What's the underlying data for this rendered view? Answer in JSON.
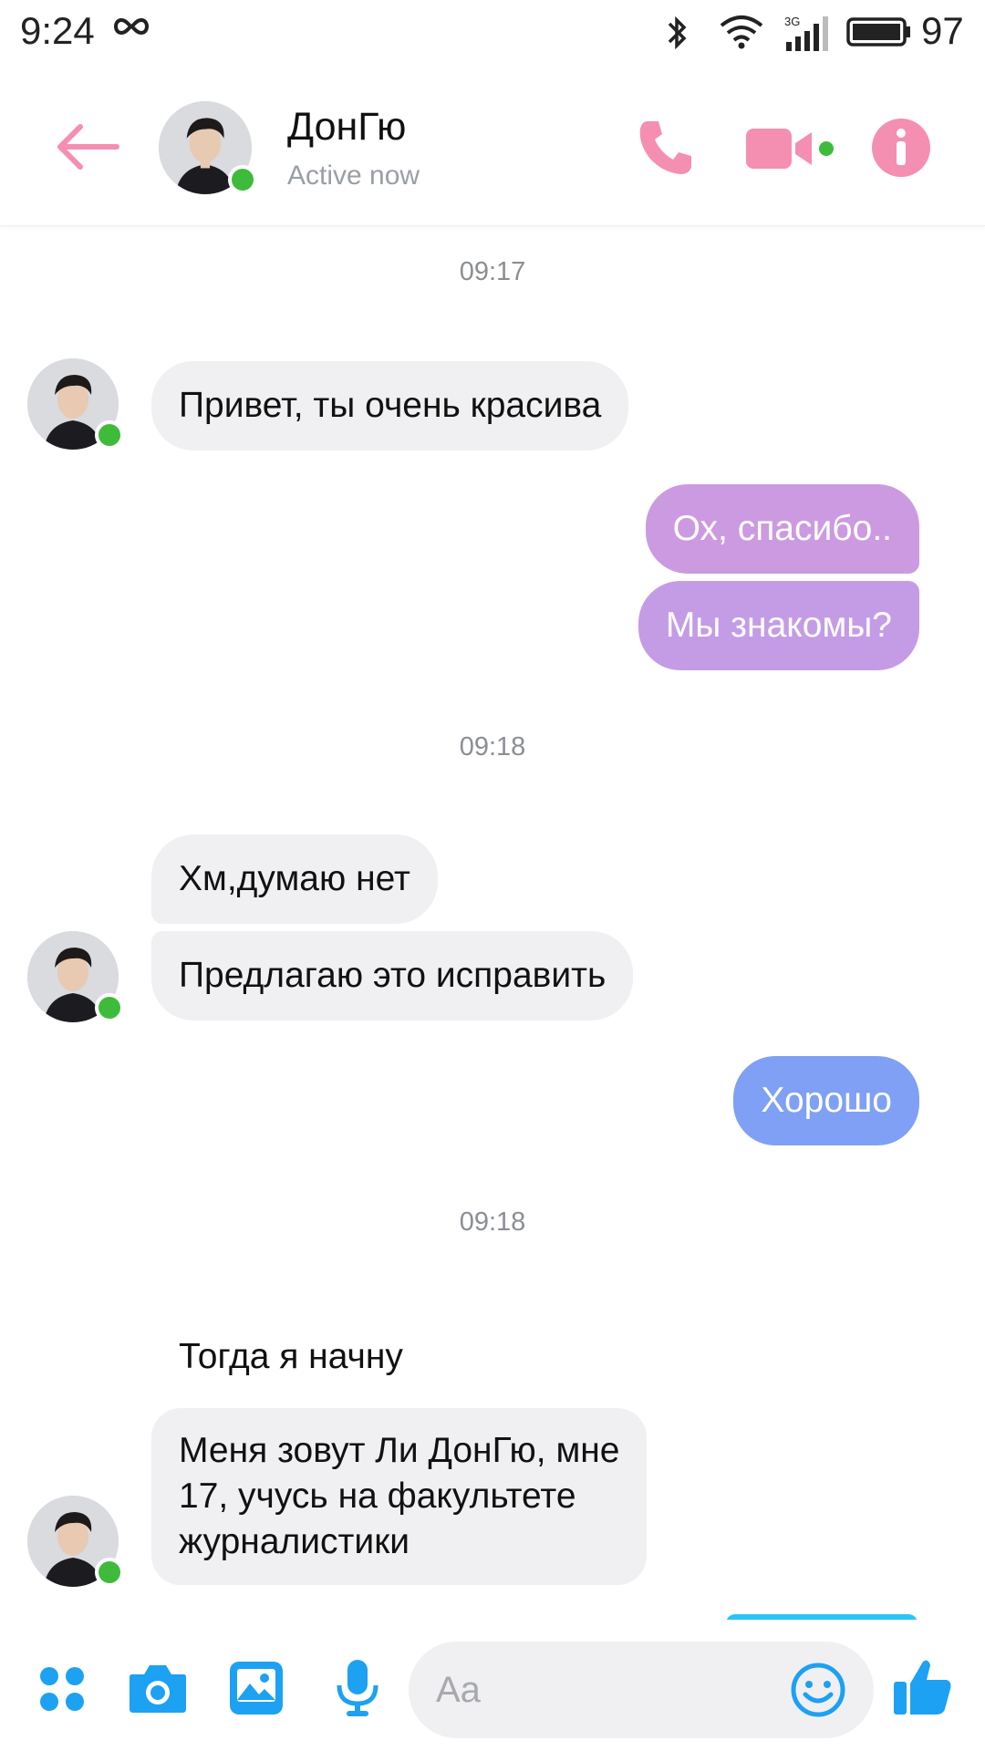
{
  "status_bar": {
    "time": "9:24",
    "network": "3G",
    "battery": "97"
  },
  "header": {
    "contact_name": "ДонГю",
    "status": "Active now",
    "accent_color": "#f48fb1",
    "icons": [
      "back-arrow-icon",
      "phone-icon",
      "video-camera-icon",
      "info-icon"
    ]
  },
  "messages": [
    {
      "type": "timestamp",
      "text": "09:17"
    },
    {
      "type": "incoming",
      "text": "Привет, ты очень красива"
    },
    {
      "type": "outgoing",
      "text": "Ох, спасибо..",
      "color": "#cc9ae0"
    },
    {
      "type": "outgoing",
      "text": "Мы знакомы?",
      "color": "#c49ce6"
    },
    {
      "type": "timestamp",
      "text": "09:18"
    },
    {
      "type": "incoming",
      "text": "Хм,думаю нет"
    },
    {
      "type": "incoming",
      "text": "Предлагаю это исправить"
    },
    {
      "type": "outgoing",
      "text": "Хорошо",
      "color": "#7fa0f4"
    },
    {
      "type": "timestamp",
      "text": "09:18"
    },
    {
      "type": "incoming_plain",
      "text": "Тогда я начну"
    },
    {
      "type": "incoming",
      "lines": [
        "Меня зовут Ли ДонГю, мне",
        "17, учусь на факультете",
        "журналистики"
      ]
    }
  ],
  "composer": {
    "placeholder": "Aa",
    "accent_color": "#1da1f2",
    "icons": [
      "apps-grid-icon",
      "camera-icon",
      "image-icon",
      "microphone-icon",
      "emoji-icon",
      "thumbs-up-icon"
    ]
  }
}
